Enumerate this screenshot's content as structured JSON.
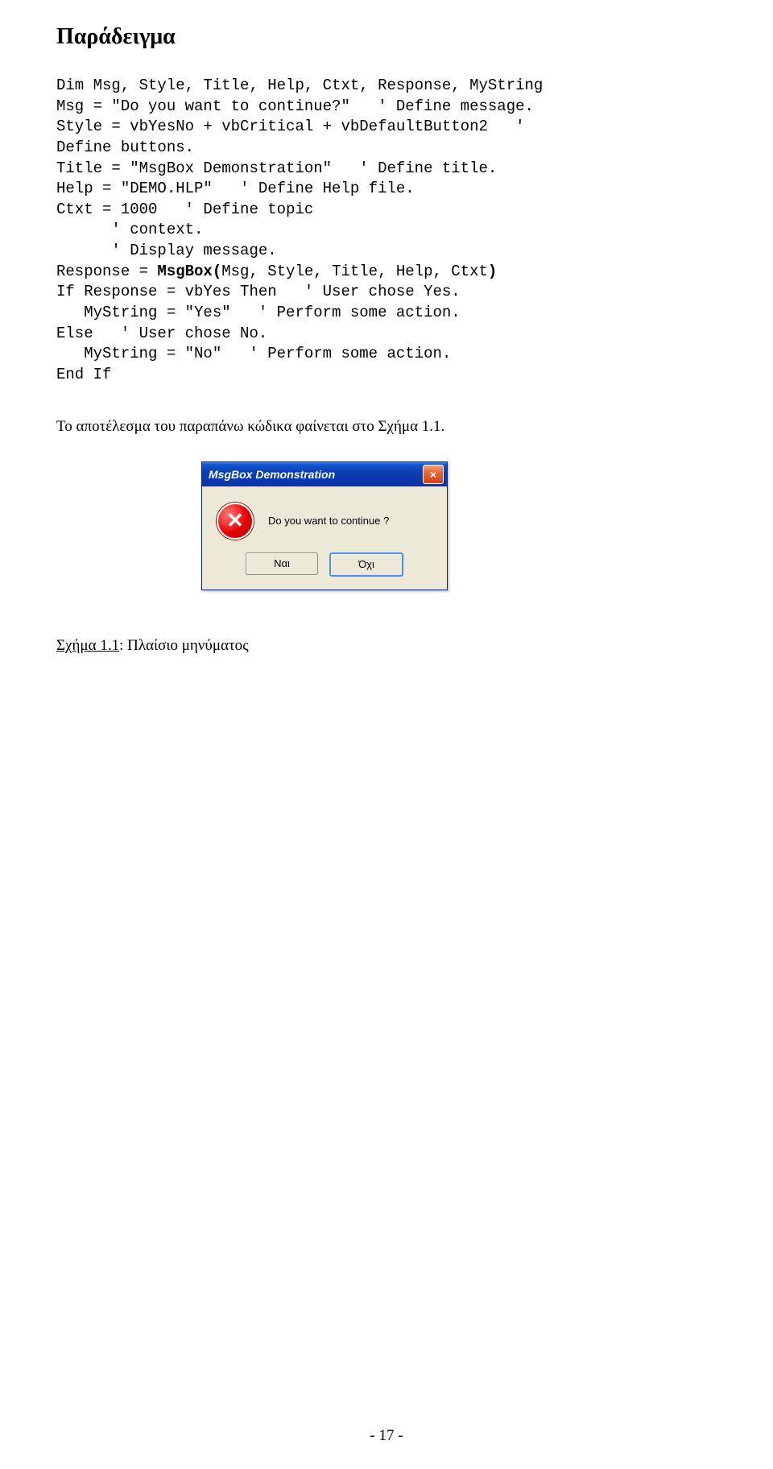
{
  "heading": "Παράδειγμα",
  "code": {
    "l01": "Dim Msg, Style, Title, Help, Ctxt, Response, MyString",
    "l02": "Msg = \"Do you want to continue?\"   ' Define message.",
    "l03": "Style = vbYesNo + vbCritical + vbDefaultButton2   '",
    "l04": "Define buttons.",
    "l05": "Title = \"MsgBox Demonstration\"   ' Define title.",
    "l06": "Help = \"DEMO.HLP\"   ' Define Help file.",
    "l07": "Ctxt = 1000   ' Define topic",
    "l08": "      ' context.",
    "l09": "      ' Display message.",
    "l10a": "Response = ",
    "l10b": "MsgBox(",
    "l10c": "Msg, Style, Title, Help, Ctxt",
    "l10d": ")",
    "l11": "If Response = vbYes Then   ' User chose Yes.",
    "l12": "   MyString = \"Yes\"   ' Perform some action.",
    "l13": "Else   ' User chose No.",
    "l14": "   MyString = \"No\"   ' Perform some action.",
    "l15": "End If"
  },
  "result_text": "Το αποτέλεσμα του παραπάνω κώδικα φαίνεται στο Σχήμα 1.1.",
  "msgbox": {
    "title": "MsgBox Demonstration",
    "close_glyph": "×",
    "icon_glyph": "✕",
    "message": "Do you want to continue ?",
    "btn_yes": "Ναι",
    "btn_no": "Όχι"
  },
  "caption": {
    "label": "Σχήμα 1.1",
    "sep": ": ",
    "text": "Πλαίσιο μηνύματος"
  },
  "page_number": "- 17 -"
}
